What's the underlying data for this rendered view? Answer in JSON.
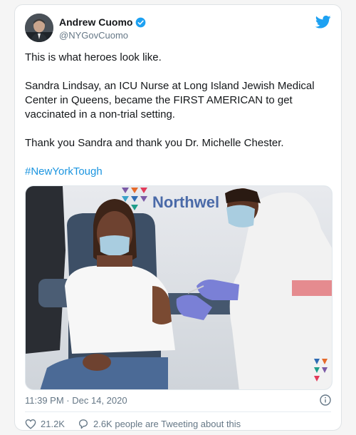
{
  "author": {
    "display_name": "Andrew Cuomo",
    "handle": "@NYGovCuomo"
  },
  "tweet": {
    "line1": "This is what heroes look like.",
    "line2": "Sandra Lindsay, an ICU Nurse at Long Island Jewish Medical Center in Queens, became the FIRST AMERICAN to get vaccinated in a non-trial setting.",
    "line3": "Thank you Sandra and thank you Dr. Michelle Chester.",
    "hashtag": "#NewYorkTough"
  },
  "media": {
    "sign_text": "Northwel"
  },
  "meta": {
    "timestamp": "11:39 PM · Dec 14, 2020",
    "likes": "21.2K",
    "tweeting": "2.6K people are Tweeting about this"
  },
  "icons": {
    "verified": "verified-badge-icon",
    "bird": "twitter-bird-icon",
    "info": "info-icon",
    "heart": "heart-icon",
    "reply": "reply-bubble-icon"
  },
  "colors": {
    "accent": "#1da1f2",
    "link": "#1b95e0",
    "muted": "#657786"
  }
}
